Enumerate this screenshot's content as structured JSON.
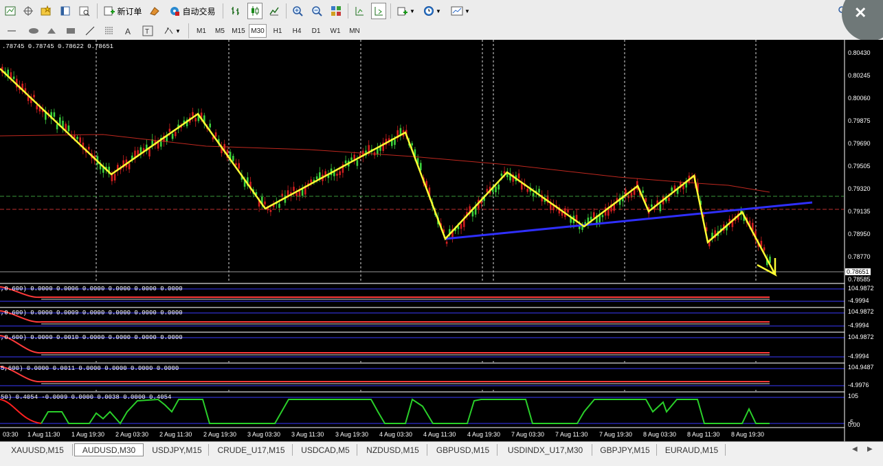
{
  "toolbar": {
    "new_order": "新订单",
    "auto_trading": "自动交易",
    "timeframes": [
      "M1",
      "M5",
      "M15",
      "M30",
      "H1",
      "H4",
      "D1",
      "W1",
      "MN"
    ],
    "active_timeframe": "M30"
  },
  "chart": {
    "ohlc": ".78745 0.78745 0.78622 0.78651",
    "current_price": "0.78651",
    "price_labels": [
      "0.80430",
      "0.80245",
      "0.80060",
      "0.79875",
      "0.79690",
      "0.79505",
      "0.79320",
      "0.79135",
      "0.78950",
      "0.78770",
      "0.78585"
    ],
    "time_labels": [
      "03:30",
      "1 Aug 11:30",
      "1 Aug 19:30",
      "2 Aug 03:30",
      "2 Aug 11:30",
      "2 Aug 19:30",
      "3 Aug 03:30",
      "3 Aug 11:30",
      "3 Aug 19:30",
      "4 Aug 03:30",
      "4 Aug 11:30",
      "4 Aug 19:30",
      "7 Aug 03:30",
      "7 Aug 11:30",
      "7 Aug 19:30",
      "8 Aug 03:30",
      "8 Aug 11:30",
      "8 Aug 19:30"
    ],
    "indicators": [
      {
        "label": ",0.600) 0.0000 0.0006 0.0000 0.0000 0.0000 0.0000",
        "top_value": "104.9872",
        "bottom_value": "-4.9994"
      },
      {
        "label": ",0.600) 0.0000 0.0009 0.0000 0.0000 0.0000 0.0000",
        "top_value": "104.9872",
        "bottom_value": "-4.9994"
      },
      {
        "label": ",0.600) 0.0000 0.0010 0.0000 0.0000 0.0000 0.0000",
        "top_value": "104.9872",
        "bottom_value": "-4.9994"
      },
      {
        "label": "5,600) 0.0000 0.0011 0.0000 0.0000 0.0000 0.0000",
        "top_value": "104.9487",
        "bottom_value": "-4.9976"
      },
      {
        "label": "50) 0.4054 -0.0009 0.0000 0.0038 0.0000 0.4054",
        "top_value": "105",
        "bottom_value": "-5",
        "zero_value": "0.00"
      }
    ]
  },
  "tabs": [
    "XAUUSD,M15",
    "AUDUSD,M30",
    "USDJPY,M15",
    "CRUDE_U17,M15",
    "USDCAD,M5",
    "NZDUSD,M15",
    "GBPUSD,M15",
    "USDINDX_U17,M30",
    "GBPJPY,M15",
    "EURAUD,M15"
  ],
  "active_tab": "AUDUSD,M30",
  "colors": {
    "zigzag": "#ffff33",
    "trendline": "#2f2fff",
    "moving_average": "#c0281f",
    "bull_candle": "#3cd13c",
    "bear_candle": "#d21f1f"
  }
}
